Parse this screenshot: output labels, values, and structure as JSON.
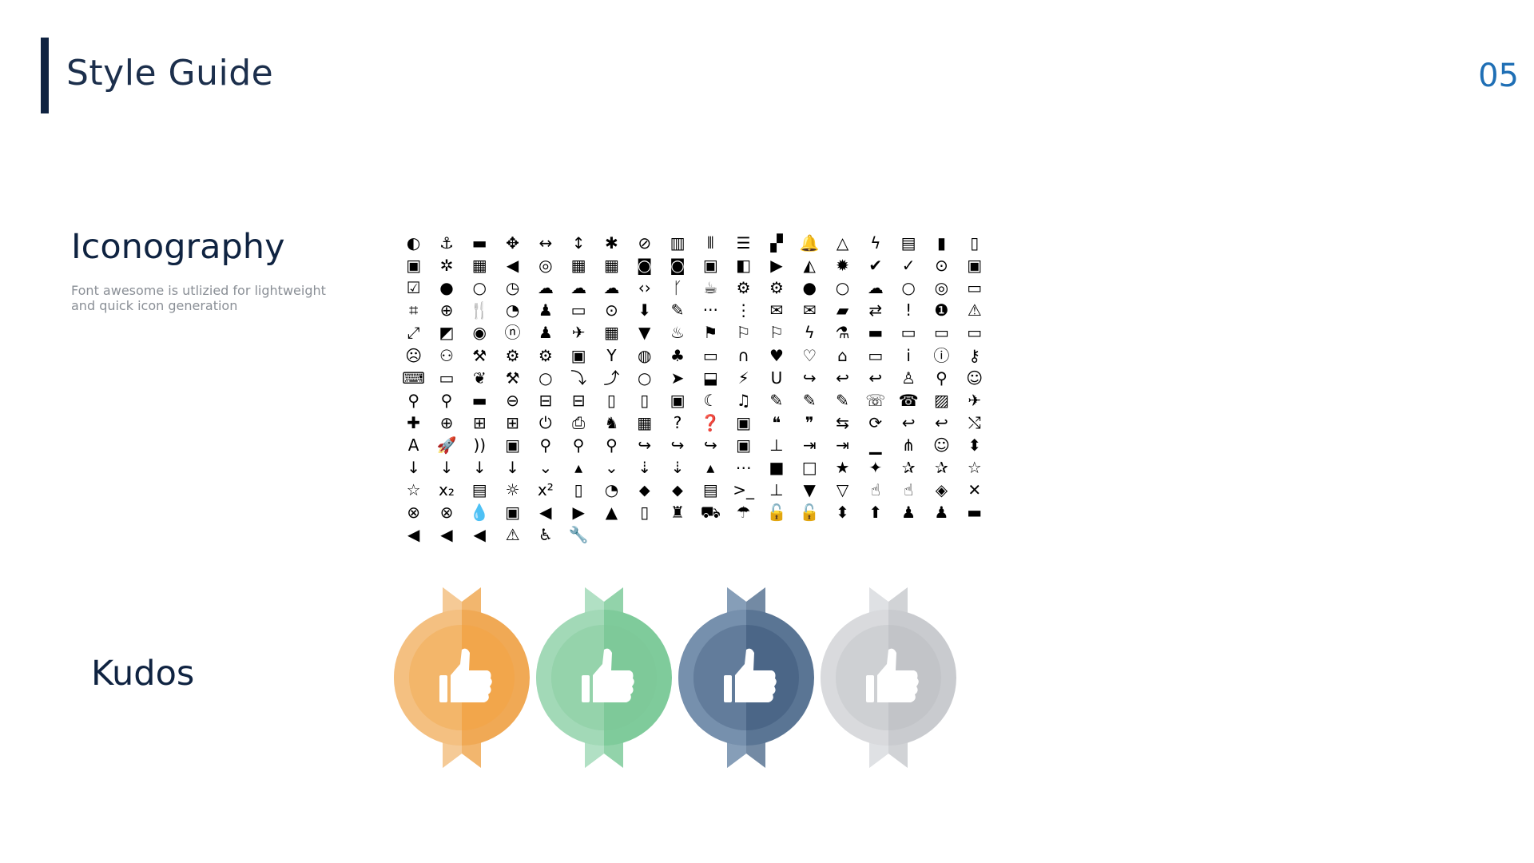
{
  "header": {
    "title": "Style Guide",
    "page_number": "05"
  },
  "iconography": {
    "heading": "Iconography",
    "description": "Font awesome is utlizied for lightweight and quick icon generation",
    "icons": [
      "◐",
      "⚓",
      "▬",
      "✥",
      "↔",
      "↕",
      "✱",
      "⊘",
      "▥",
      "⦀",
      "☰",
      "▞",
      "🔔",
      "△",
      "ϟ",
      "▤",
      "▮",
      "▯",
      "▣",
      "✲",
      "▦",
      "◀",
      "◎",
      "▦",
      "▦",
      "◙",
      "◙",
      "▣",
      "◧",
      "▶",
      "◭",
      "✹",
      "✔",
      "✓",
      "⊙",
      "▣",
      "☑",
      "●",
      "○",
      "◷",
      "☁",
      "☁",
      "☁",
      "‹›",
      "ᚴ",
      "☕",
      "⚙",
      "⚙",
      "●",
      "○",
      "☁",
      "○",
      "◎",
      "▭",
      "⌗",
      "⊕",
      "🍴",
      "◔",
      "♟",
      "▭",
      "⊙",
      "⬇",
      "✎",
      "···",
      "⋮",
      "✉",
      "✉",
      "▰",
      "⇄",
      "!",
      "❶",
      "⚠",
      "⤢",
      "◩",
      "◉",
      "ⓝ",
      "♟",
      "✈",
      "▦",
      "▼",
      "♨",
      "⚑",
      "⚐",
      "⚐",
      "ϟ",
      "⚗",
      "▬",
      "▭",
      "▭",
      "▭",
      "☹",
      "⚇",
      "⚒",
      "⚙",
      "⚙",
      "▣",
      "Y",
      "◍",
      "♣",
      "▭",
      "∩",
      "♥",
      "♡",
      "⌂",
      "▭",
      "i",
      "ⓘ",
      "⚷",
      "⌨",
      "▭",
      "❦",
      "⚒",
      "○",
      "⤵",
      "⤴",
      "○",
      "➤",
      "⬓",
      "⚡",
      "U",
      "↪",
      "↩",
      "↩",
      "♙",
      "⚲",
      "☺",
      "⚲",
      "⚲",
      "▬",
      "⊖",
      "⊟",
      "⊟",
      "▯",
      "▯",
      "▣",
      "☾",
      "♫",
      "✎",
      "✎",
      "✎",
      "☏",
      "☎",
      "▨",
      "✈",
      "✚",
      "⊕",
      "⊞",
      "⊞",
      "⏻",
      "⎙",
      "♞",
      "▦",
      "?",
      "❓",
      "▣",
      "❝",
      "❞",
      "⇆",
      "⟳",
      "↩",
      "↩",
      "⤭",
      "A",
      "🚀",
      "))",
      "▣",
      "⚲",
      "⚲",
      "⚲",
      "↪",
      "↪",
      "↪",
      "▣",
      "⊥",
      "⇥",
      "⇥",
      "▁",
      "⋔",
      "☺",
      "⬍",
      "↓",
      "↓",
      "↓",
      "↓",
      "⌄",
      "▴",
      "⌄",
      "⇣",
      "⇣",
      "▴",
      "⋯",
      "■",
      "□",
      "★",
      "✦",
      "✰",
      "✰",
      "☆",
      "☆",
      "x₂",
      "▤",
      "☼",
      "x²",
      "▯",
      "◔",
      "⬥",
      "⬥",
      "▤",
      ">_",
      "⊥",
      "▼",
      "▽",
      "☝",
      "☝",
      "◈",
      "✕",
      "⊗",
      "⊗",
      "💧",
      "▣",
      "◀",
      "▶",
      "▲",
      "▯",
      "♜",
      "⛟",
      "☂",
      "🔓",
      "🔓",
      "⬍",
      "⬆",
      "♟",
      "♟",
      "▬",
      "◀",
      "◀",
      "◀",
      "⚠",
      "♿",
      "🔧"
    ]
  },
  "kudos": {
    "heading": "Kudos",
    "medals": [
      {
        "name": "bronze",
        "color": "#f0a955",
        "edge": "#f7d3a6",
        "inner": "#f2a64b"
      },
      {
        "name": "green",
        "color": "#7fcb9b",
        "edge": "#bfe6ce",
        "inner": "#7ec999"
      },
      {
        "name": "blue",
        "color": "#5a7594",
        "edge": "#8ea6c1",
        "inner": "#4b6687"
      },
      {
        "name": "silver",
        "color": "#c9cbcf",
        "edge": "#e6e7e9",
        "inner": "#c2c4c8"
      }
    ]
  }
}
